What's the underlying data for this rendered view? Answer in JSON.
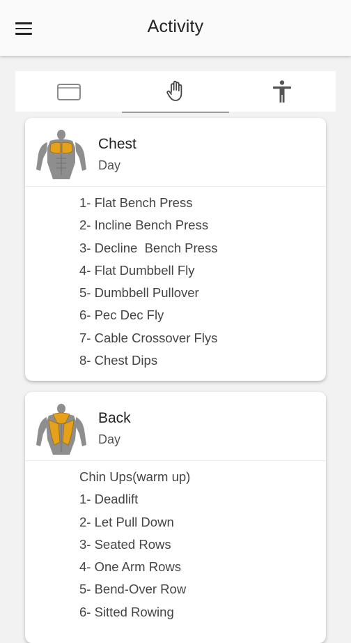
{
  "header": {
    "title": "Activity",
    "menu_icon": "hamburger-menu-icon"
  },
  "tabs": [
    {
      "icon": "tablet-icon",
      "active": false
    },
    {
      "icon": "hand-icon",
      "active": true
    },
    {
      "icon": "person-icon",
      "active": false
    }
  ],
  "cards": [
    {
      "title": "Chest",
      "subtitle": "Day",
      "icon": "chest-muscle-icon",
      "highlight_color": "#e5a11a",
      "items": [
        "1- Flat Bench Press",
        "2- Incline Bench Press",
        "3- Decline  Bench Press",
        "4- Flat Dumbbell Fly",
        "5- Dumbbell Pullover",
        "6- Pec Dec Fly",
        "7- Cable Crossover Flys",
        "8- Chest Dips"
      ]
    },
    {
      "title": "Back",
      "subtitle": "Day",
      "icon": "back-muscle-icon",
      "highlight_color": "#e5a11a",
      "items": [
        "Chin Ups(warm up)",
        "1- Deadlift",
        "2- Let Pull Down",
        "3- Seated Rows",
        "4- One Arm Rows",
        "5- Bend-Over Row",
        "6- Sitted Rowing"
      ]
    }
  ]
}
